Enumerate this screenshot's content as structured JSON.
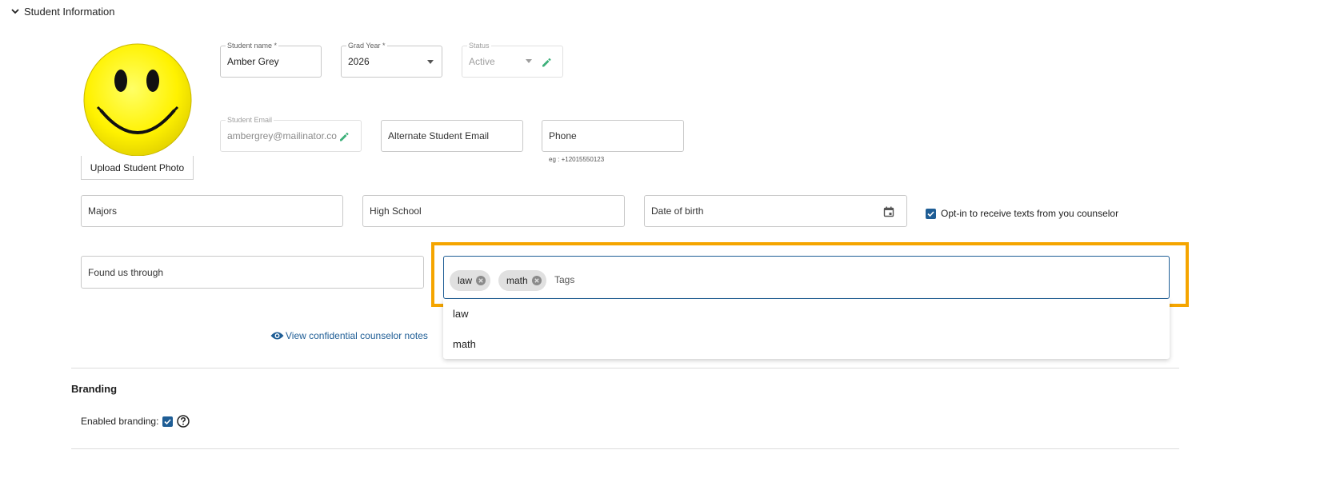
{
  "section": {
    "title": "Student Information",
    "toggle_icon": "chevron-down-icon"
  },
  "photo": {
    "upload_label": "Upload Student Photo"
  },
  "fields": {
    "student_name": {
      "label": "Student name *",
      "value": "Amber Grey"
    },
    "grad_year": {
      "label": "Grad Year *",
      "value": "2026"
    },
    "status": {
      "label": "Status",
      "value": "Active"
    },
    "student_email": {
      "label": "Student Email",
      "value": "ambergrey@mailinator.co"
    },
    "alt_email": {
      "placeholder": "Alternate Student Email"
    },
    "phone": {
      "placeholder": "Phone",
      "hint": "eg : +12015550123"
    },
    "majors": {
      "placeholder": "Majors"
    },
    "high_school": {
      "placeholder": "High School"
    },
    "dob": {
      "placeholder": "Date of birth",
      "icon": "calendar-icon"
    },
    "found_us": {
      "placeholder": "Found us through"
    }
  },
  "optin": {
    "label": "Opt-in to receive texts from you counselor",
    "checked": true
  },
  "tags": {
    "placeholder": "Tags",
    "chips": [
      "law",
      "math"
    ],
    "options": [
      "law",
      "math"
    ]
  },
  "confidential_link": "View confidential counselor notes",
  "branding": {
    "title": "Branding",
    "enabled_label": "Enabled branding:",
    "enabled": true
  },
  "colors": {
    "accent": "#1e5d95",
    "highlight": "#f5a500",
    "edit_green": "#3db07a"
  }
}
